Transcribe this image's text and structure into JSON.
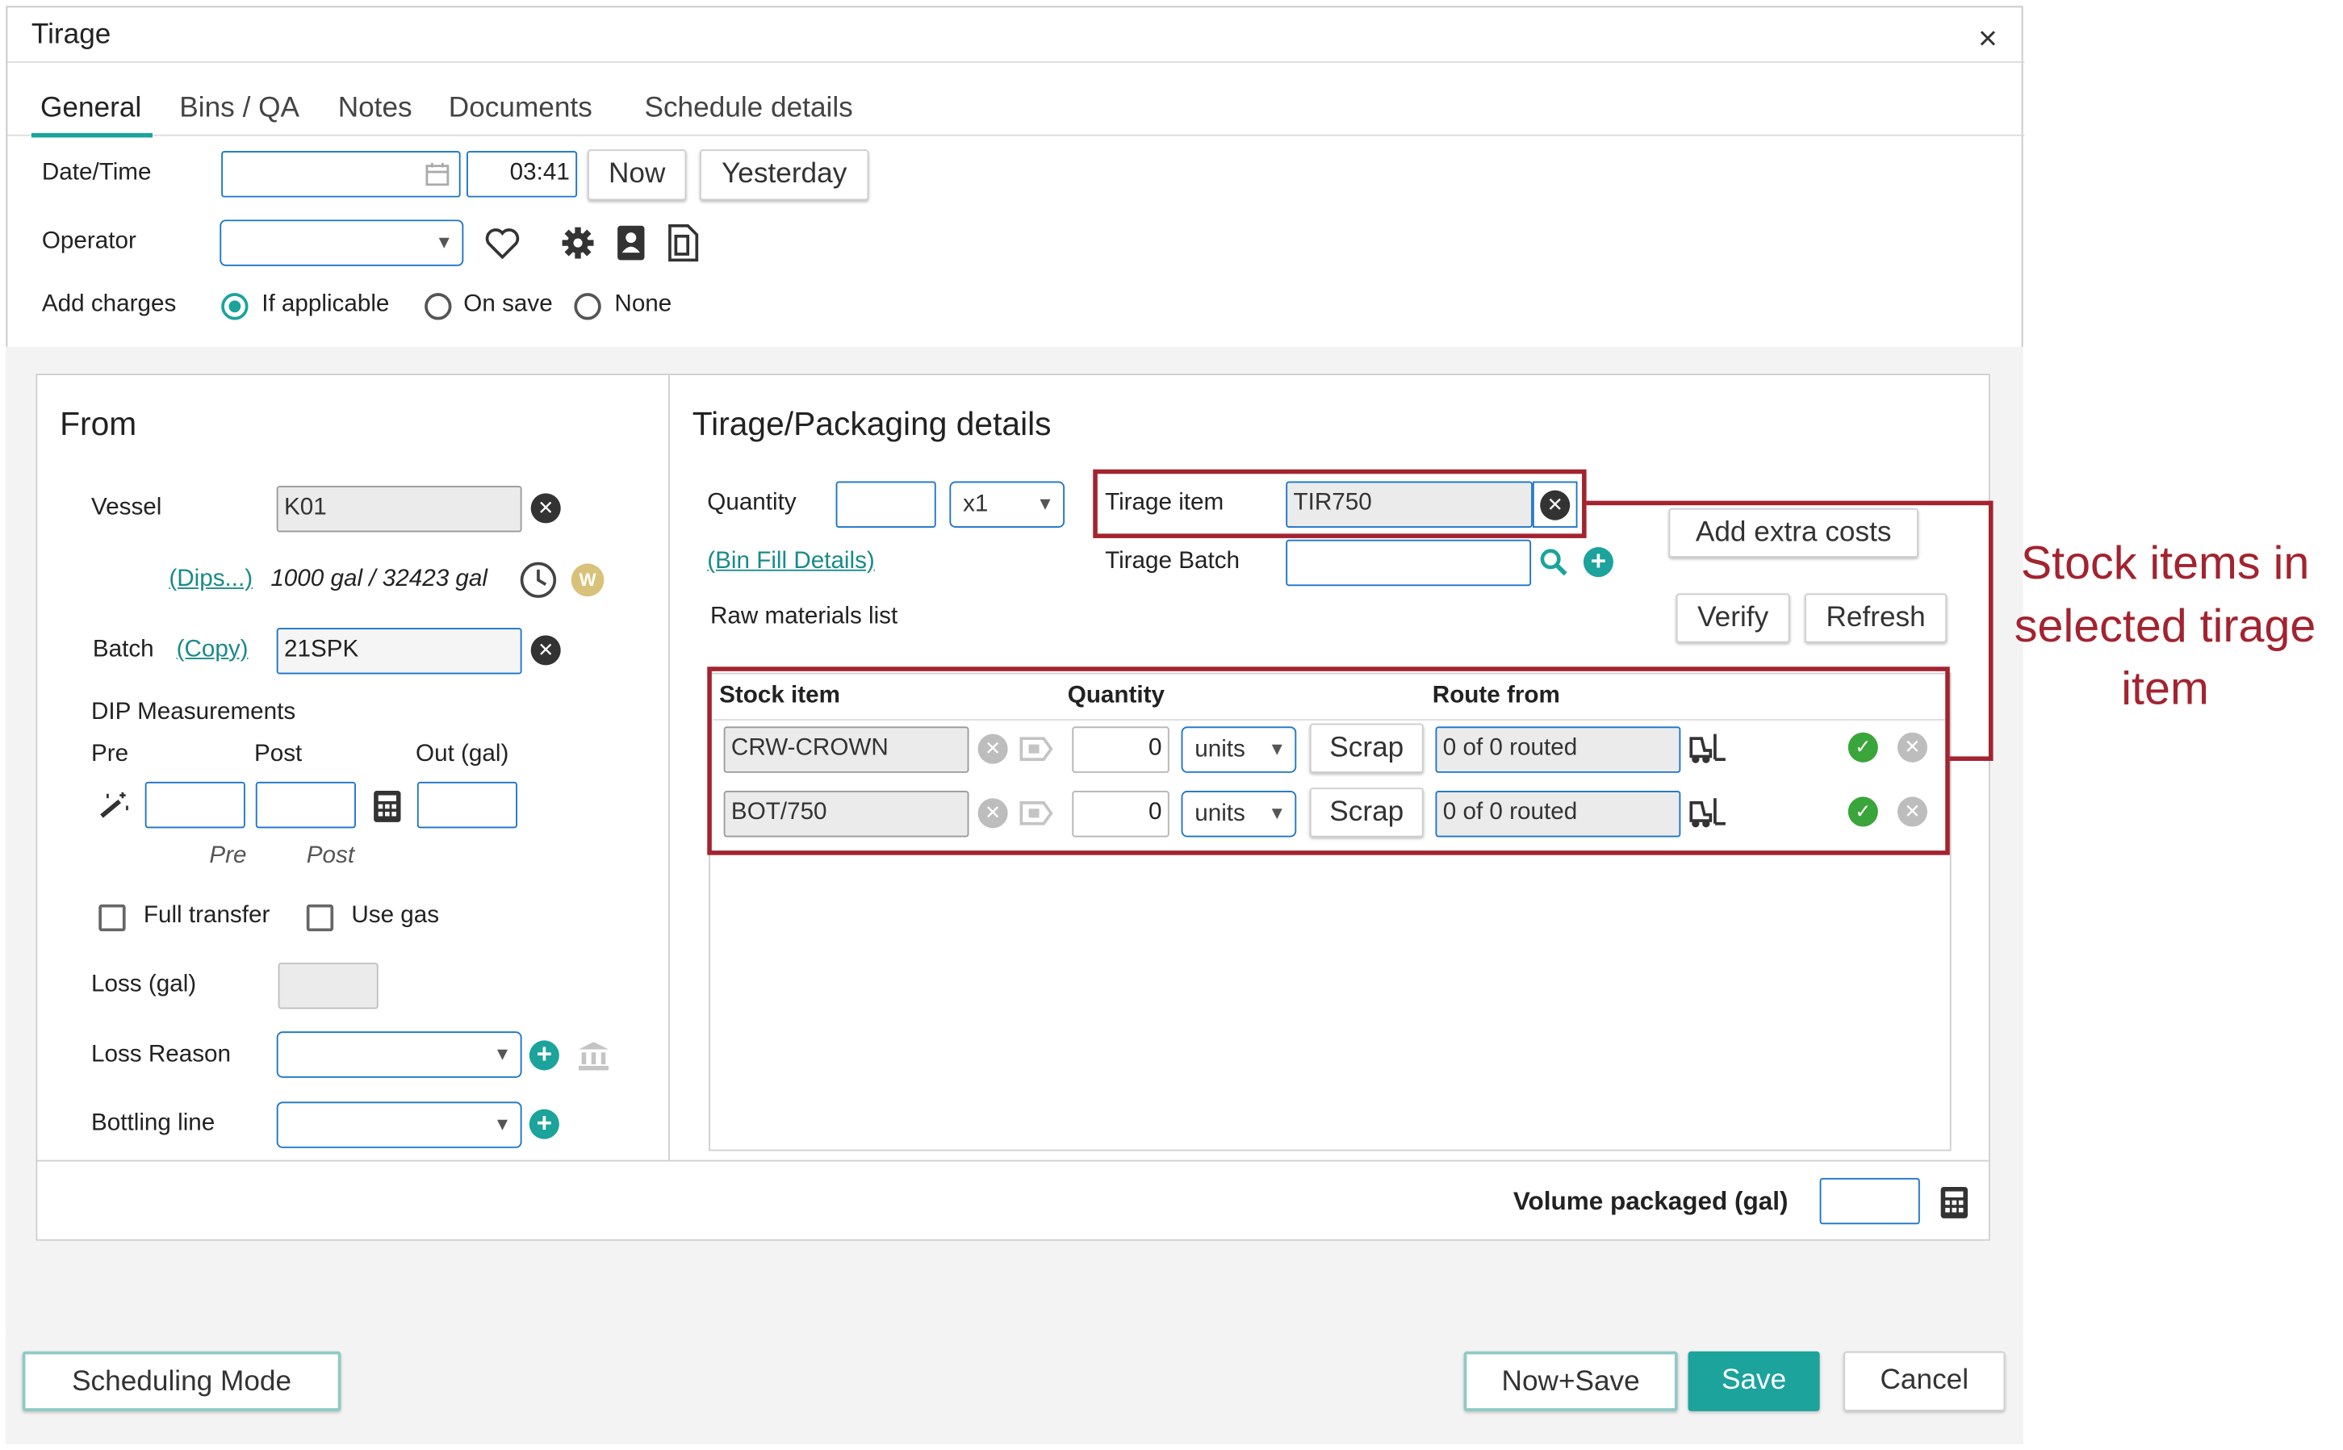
{
  "dialog": {
    "title": "Tirage",
    "close_glyph": "×"
  },
  "tabs": [
    {
      "label": "General",
      "active": true
    },
    {
      "label": "Bins / QA"
    },
    {
      "label": "Notes"
    },
    {
      "label": "Documents"
    },
    {
      "label": "Schedule details"
    }
  ],
  "general": {
    "datetime_label": "Date/Time",
    "date_value": "",
    "time_value": "03:41",
    "now_button": "Now",
    "yesterday_button": "Yesterday",
    "operator_label": "Operator",
    "operator_value": "",
    "add_charges_label": "Add charges",
    "charges_options": [
      "If applicable",
      "On save",
      "None"
    ],
    "charges_selected": "If applicable"
  },
  "from": {
    "heading": "From",
    "vessel_label": "Vessel",
    "vessel_value": "K01",
    "dips_link": "(Dips...)",
    "volume_text": "1000 gal / 32423 gal",
    "w_badge": "W",
    "batch_label": "Batch",
    "copy_link": "(Copy)",
    "batch_value": "21SPK",
    "dip_heading": "DIP Measurements",
    "pre_label": "Pre",
    "post_label": "Post",
    "out_label": "Out (gal)",
    "pre_hint": "Pre",
    "post_hint": "Post",
    "full_transfer_label": "Full transfer",
    "use_gas_label": "Use gas",
    "loss_label": "Loss (gal)",
    "loss_reason_label": "Loss Reason",
    "bottling_line_label": "Bottling line"
  },
  "details": {
    "heading": "Tirage/Packaging details",
    "quantity_label": "Quantity",
    "quantity_value": "",
    "multiplier": "x1",
    "bin_fill_link": "(Bin Fill Details)",
    "tirage_item_label": "Tirage item",
    "tirage_item_value": "TIR750",
    "tirage_batch_label": "Tirage Batch",
    "add_extra_costs_button": "Add extra costs",
    "raw_materials_label": "Raw materials list",
    "verify_button": "Verify",
    "refresh_button": "Refresh",
    "columns": [
      "Stock item",
      "Quantity",
      "Route from"
    ],
    "rows": [
      {
        "item": "CRW-CROWN",
        "qty": "0",
        "unit": "units",
        "scrap": "Scrap",
        "route": "0 of 0 routed"
      },
      {
        "item": "BOT/750",
        "qty": "0",
        "unit": "units",
        "scrap": "Scrap",
        "route": "0 of 0 routed"
      }
    ],
    "volume_packaged_label": "Volume packaged (gal)"
  },
  "annotation": {
    "text": "Stock items in selected tirage item",
    "color": "#a3232f"
  },
  "footer": {
    "scheduling_button": "Scheduling Mode",
    "now_save_button": "Now+Save",
    "save_button": "Save",
    "cancel_button": "Cancel"
  },
  "colors": {
    "accent": "#1ba39c",
    "annotation_red": "#a3232f",
    "input_border": "#1a74c9"
  }
}
